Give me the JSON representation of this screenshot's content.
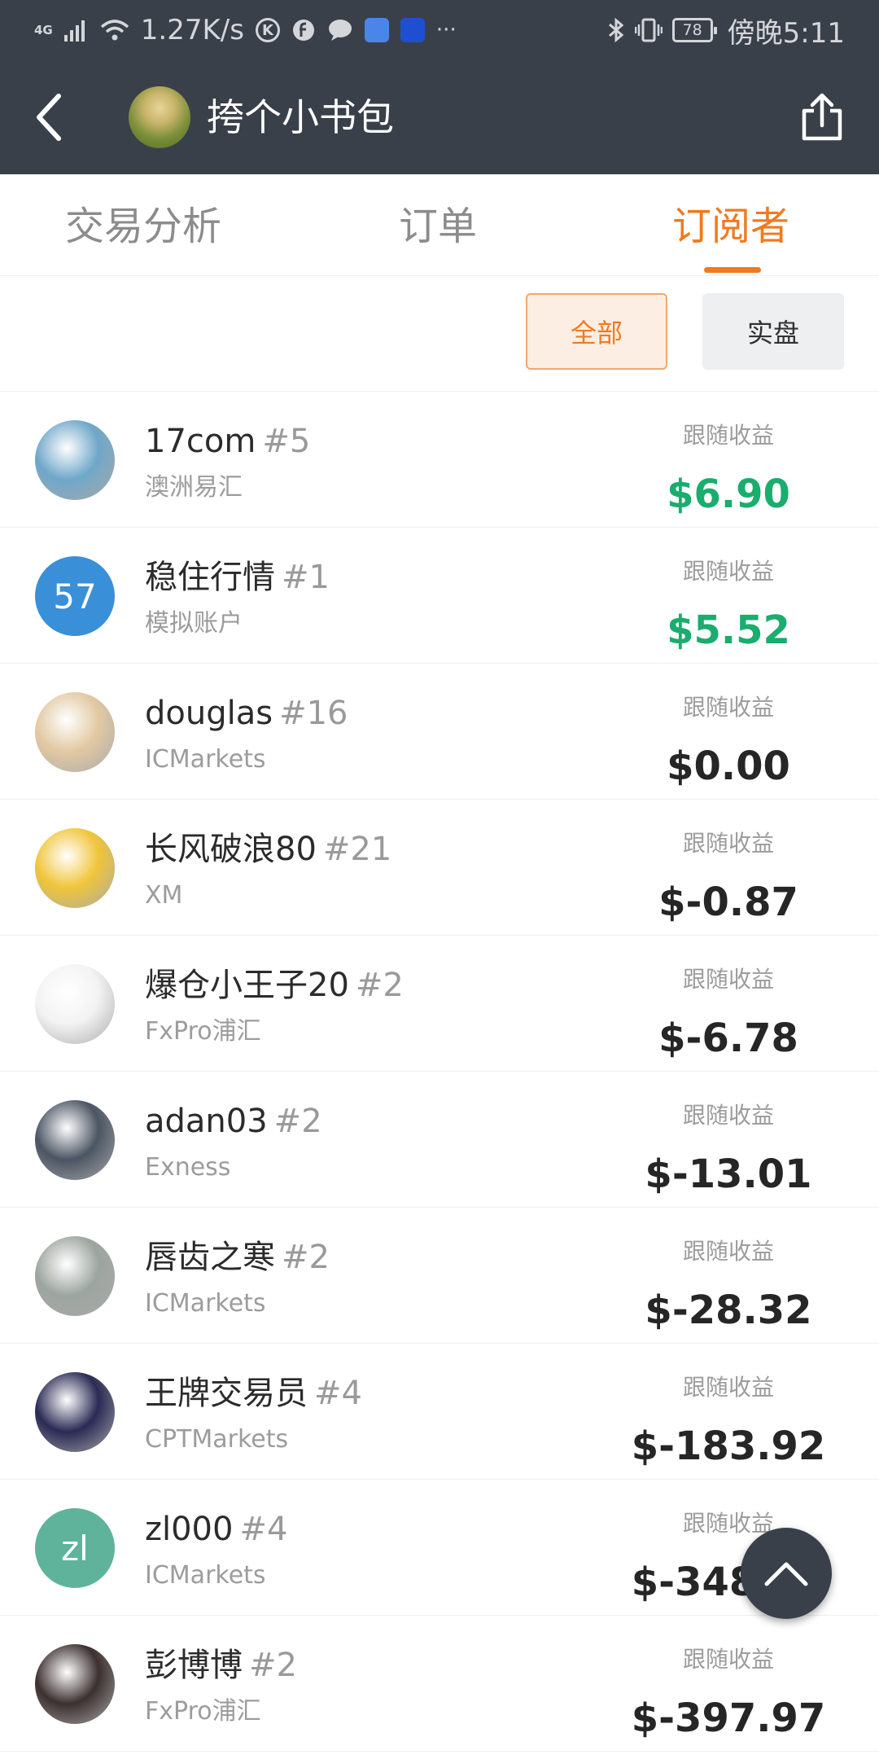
{
  "status_bar": {
    "network": "4G",
    "speed": "1.27K/s",
    "battery": "78",
    "time": "傍晚5:11",
    "more": "···"
  },
  "header": {
    "title": "挎个小书包"
  },
  "tabs": [
    {
      "label": "交易分析"
    },
    {
      "label": "订单"
    },
    {
      "label": "订阅者"
    }
  ],
  "filters": {
    "all": "全部",
    "live": "实盘"
  },
  "profit_label": "跟随收益",
  "subscribers": [
    {
      "name": "17com",
      "rank": "#5",
      "broker": "澳洲易汇",
      "profit": "$6.90",
      "positive": true,
      "avatar_color": "#6fa7c9"
    },
    {
      "name": "稳住行情",
      "rank": "#1",
      "broker": "模拟账户",
      "profit": "$5.52",
      "positive": true,
      "avatar_text": "57",
      "avatar_color": "#3a8fd9"
    },
    {
      "name": "douglas",
      "rank": "#16",
      "broker": "ICMarkets",
      "profit": "$0.00",
      "positive": false,
      "avatar_color": "#e2c9a2"
    },
    {
      "name": "长风破浪80",
      "rank": "#21",
      "broker": "XM",
      "profit": "$-0.87",
      "positive": false,
      "avatar_color": "#f0c53a"
    },
    {
      "name": "爆仓小王子20",
      "rank": "#2",
      "broker": "FxPro浦汇",
      "profit": "$-6.78",
      "positive": false,
      "avatar_color": "#f3f3f3"
    },
    {
      "name": "adan03",
      "rank": "#2",
      "broker": "Exness",
      "profit": "$-13.01",
      "positive": false,
      "avatar_color": "#4b5563"
    },
    {
      "name": "唇齿之寒",
      "rank": "#2",
      "broker": "ICMarkets",
      "profit": "$-28.32",
      "positive": false,
      "avatar_color": "#9da5a0"
    },
    {
      "name": "王牌交易员",
      "rank": "#4",
      "broker": "CPTMarkets",
      "profit": "$-183.92",
      "positive": false,
      "avatar_color": "#2a2a55"
    },
    {
      "name": "zl000",
      "rank": "#4",
      "broker": "ICMarkets",
      "profit": "$-348.83",
      "positive": false,
      "avatar_text": "zl",
      "avatar_color": "#5fb39a"
    },
    {
      "name": "彭博博",
      "rank": "#2",
      "broker": "FxPro浦汇",
      "profit": "$-397.97",
      "positive": false,
      "avatar_color": "#3c3030"
    }
  ],
  "icons": {
    "back": "chevron-left-icon",
    "share": "share-icon",
    "scroll_top": "chevron-up-icon"
  },
  "colors": {
    "header_bg": "#3a4049",
    "accent": "#f07a1f",
    "positive": "#1aad6d"
  }
}
